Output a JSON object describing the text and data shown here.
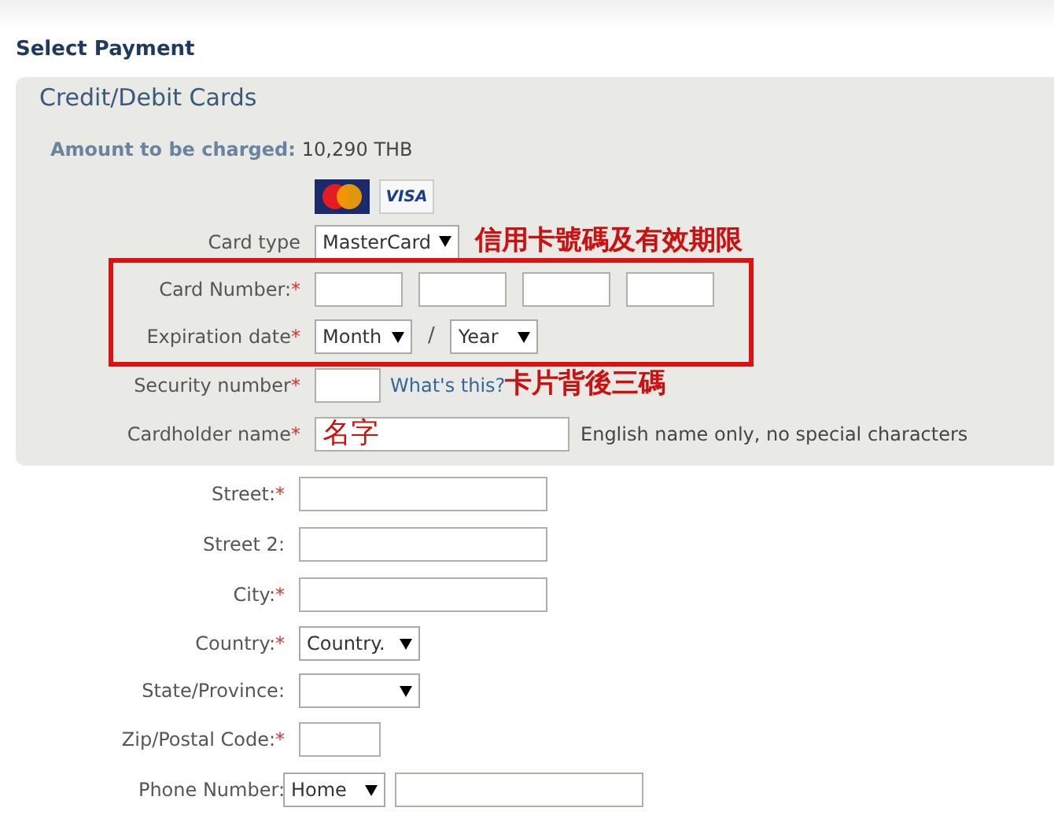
{
  "page_title": "Select Payment",
  "card_panel": {
    "heading": "Credit/Debit Cards",
    "amount_label": "Amount to be charged:",
    "amount": "10,290 THB",
    "logos": [
      {
        "kind": "mastercard"
      },
      {
        "kind": "visa",
        "label": "VISA"
      }
    ],
    "fields": [
      {
        "kind": "select",
        "label": "Card type",
        "value": "MasterCard",
        "note": "信用卡號碼及有效期限",
        "highlighted": false
      },
      {
        "kind": "card_number",
        "label": "Card Number:",
        "mark": "*",
        "highlighted": true
      },
      {
        "kind": "expiry",
        "label": "Expiration date",
        "mark": "*",
        "month": "Month",
        "separator": "/",
        "year": "Year",
        "highlighted": true
      },
      {
        "kind": "security",
        "label": "Security number",
        "mark": "*",
        "link": "What's this?",
        "note": "卡片背後三碼",
        "highlighted": false
      },
      {
        "kind": "text",
        "label": "Cardholder name",
        "mark": "*",
        "value": "名字",
        "hint": "English name only, no special characters",
        "highlighted": false
      }
    ]
  },
  "address_fields": [
    {
      "kind": "text",
      "label": "Street:",
      "mark": "*"
    },
    {
      "kind": "text",
      "label": "Street 2:"
    },
    {
      "kind": "text",
      "label": "City:",
      "mark": "*"
    },
    {
      "kind": "select",
      "label": "Country:",
      "mark": "*",
      "value": "Country."
    },
    {
      "kind": "select",
      "label": "State/Province:"
    },
    {
      "kind": "zip",
      "label": "Zip/Postal Code:",
      "mark": "*"
    },
    {
      "kind": "phone",
      "label": "Phone Number:",
      "value": "Home"
    }
  ]
}
